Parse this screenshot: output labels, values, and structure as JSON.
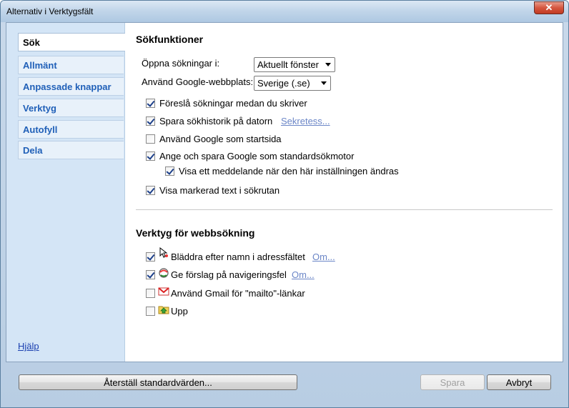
{
  "window": {
    "title": "Alternativ i Verktygsfält",
    "close_glyph": "✕"
  },
  "sidebar": {
    "tabs": [
      {
        "label": "Sök",
        "active": true
      },
      {
        "label": "Allmänt",
        "active": false
      },
      {
        "label": "Anpassade knappar",
        "active": false
      },
      {
        "label": "Verktyg",
        "active": false
      },
      {
        "label": "Autofyll",
        "active": false
      },
      {
        "label": "Dela",
        "active": false
      }
    ],
    "help": "Hjälp"
  },
  "search": {
    "title": "Sökfunktioner",
    "open_label": "Öppna sökningar i:",
    "open_value": "Aktuellt fönster",
    "site_label": "Använd Google-webbplats:",
    "site_value": "Sverige (.se)",
    "options": [
      {
        "label": "Föreslå sökningar medan du skriver",
        "checked": true
      },
      {
        "label": "Spara sökhistorik på datorn",
        "checked": true,
        "link": "Sekretess..."
      },
      {
        "label": "Använd Google som startsida",
        "checked": false
      },
      {
        "label": "Ange och spara Google som standardsökmotor",
        "checked": true
      },
      {
        "label": "Visa ett meddelande när den här inställningen ändras",
        "checked": true
      },
      {
        "label": "Visa markerad text i sökrutan",
        "checked": true
      }
    ]
  },
  "tools": {
    "title": "Verktyg för webbsökning",
    "items": [
      {
        "label": "Bläddra efter namn i adressfältet",
        "checked": true,
        "link": "Om...",
        "icon": "browse-by-name-icon"
      },
      {
        "label": "Ge förslag på navigeringsfel",
        "checked": true,
        "link": "Om...",
        "icon": "navigation-error-icon"
      },
      {
        "label": "Använd Gmail för \"mailto\"-länkar",
        "checked": false,
        "icon": "gmail-icon"
      },
      {
        "label": "Upp",
        "checked": false,
        "icon": "up-folder-icon"
      }
    ]
  },
  "footer": {
    "reset": "Återställ standardvärden...",
    "save": "Spara",
    "cancel": "Avbryt"
  }
}
